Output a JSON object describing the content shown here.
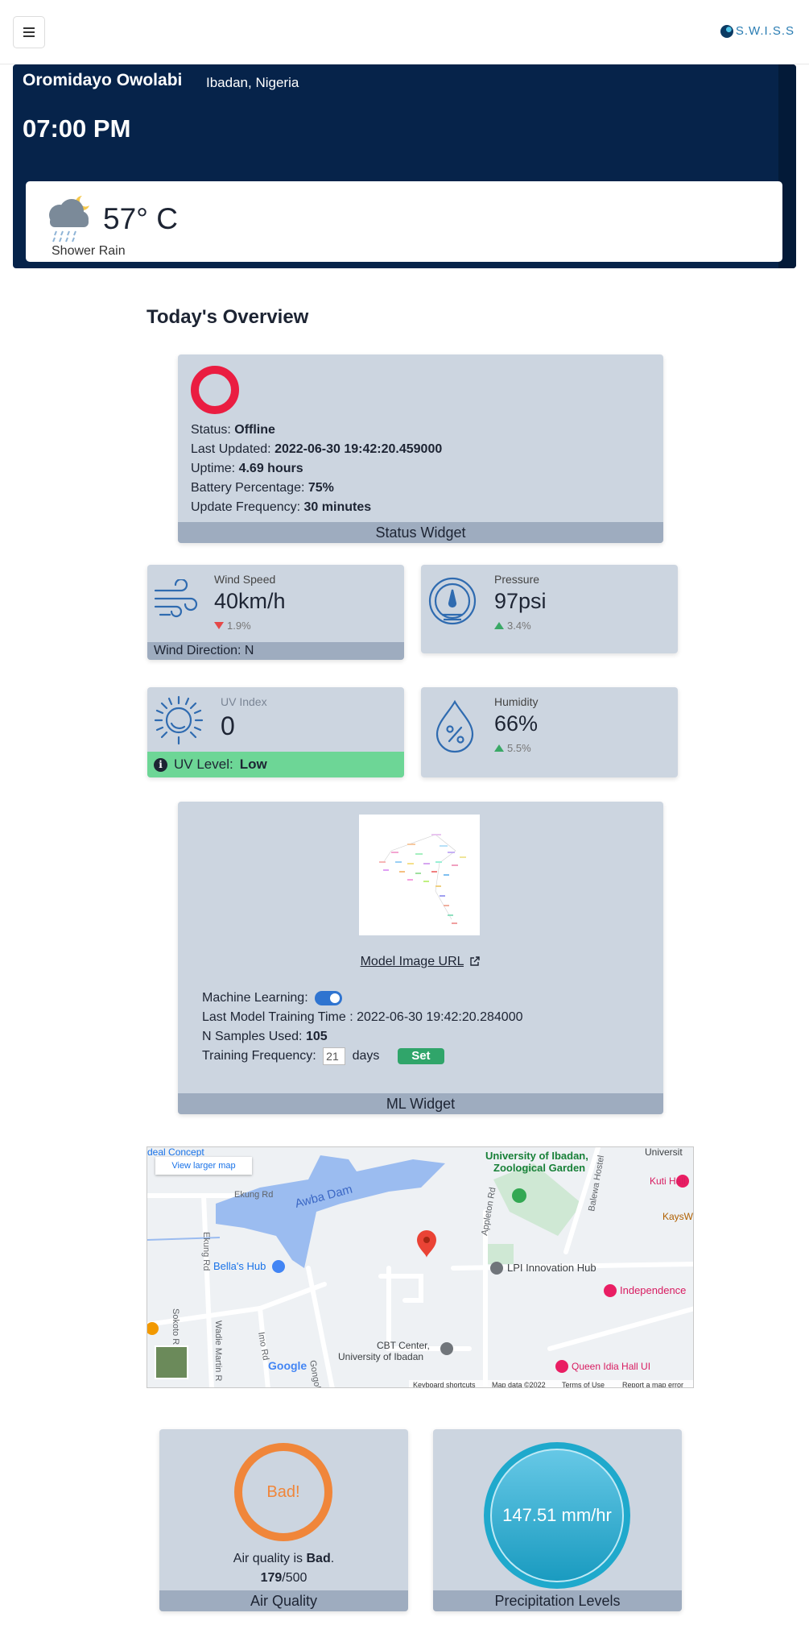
{
  "header": {
    "brand": "S.W.I.S.S",
    "menu_icon": "hamburger-icon",
    "logo_icon": "globe-logo-icon"
  },
  "hero": {
    "user_name": "Oromidayo Owolabi",
    "location": "Ibadan, Nigeria",
    "time": "07:00 PM",
    "weather": {
      "icon": "cloud-moon-rain-icon",
      "temperature": "57° C",
      "description": "Shower Rain"
    }
  },
  "overview": {
    "title": "Today's Overview",
    "status_widget": {
      "status_label": "Status: ",
      "status_value": "Offline",
      "updated_label": "Last Updated: ",
      "updated_value": "2022-06-30 19:42:20.459000",
      "uptime_label": "Uptime: ",
      "uptime_value": "4.69 hours",
      "battery_label": "Battery Percentage: ",
      "battery_value": "75%",
      "frequency_label": "Update Frequency: ",
      "frequency_value": "30 minutes",
      "footer": "Status Widget",
      "status_color": "#ea1d41"
    },
    "wind": {
      "label": "Wind Speed",
      "value": "40km/h",
      "change": "1.9%",
      "trend": "down",
      "direction": "Wind Direction: N",
      "icon": "wind-icon"
    },
    "pressure": {
      "label": "Pressure",
      "value": "97psi",
      "change": "3.4%",
      "trend": "up",
      "icon": "gauge-icon"
    },
    "uv": {
      "label": "UV Index",
      "value": "0",
      "level_label": "UV Level:",
      "level_value": "Low",
      "icon": "sun-icon"
    },
    "humidity": {
      "label": "Humidity",
      "value": "66%",
      "change": "5.5%",
      "trend": "up",
      "icon": "water-drop-percent-icon"
    },
    "ml_widget": {
      "link_text": "Model Image URL",
      "ml_label": "Machine Learning:",
      "ml_enabled": true,
      "training_time_label": "Last Model Training Time : ",
      "training_time_value": "2022-06-30 19:42:20.284000",
      "samples_label": "N Samples Used: ",
      "samples_value": "105",
      "frequency_label": "Training Frequency:",
      "frequency_value": "21",
      "frequency_unit": "days",
      "set_button": "Set",
      "footer": "ML Widget"
    },
    "map": {
      "view_larger": "View larger map",
      "places": [
        "University of Ibadan, Zoological Garden",
        "Kuti Hall",
        "KaysWeeke",
        "Bella's Hub",
        "LPI Innovation Hub",
        "Independence",
        "CBT Center, University of Ibadan",
        "Queen Idia Hall UI",
        "Awba Dam",
        "deal Concept",
        "Universit"
      ],
      "roads": [
        "Ekung Rd",
        "Ekung Rd",
        "Appleton Rd",
        "Balewa Hostel",
        "Sokoto R",
        "Wadie Martin R",
        "Imo Rd",
        "Gongol"
      ],
      "footer_items": [
        "Keyboard shortcuts",
        "Map data ©2022",
        "Terms of Use",
        "Report a map error"
      ],
      "google": "Google"
    },
    "air_quality": {
      "badge": "Bad!",
      "text_prefix": "Air quality is ",
      "text_value": "Bad",
      "text_suffix": ".",
      "score": "179",
      "score_max": "/500",
      "footer": "Air Quality",
      "ring_color": "#f0863a",
      "score_fraction": 0.358
    },
    "precipitation": {
      "value": "147.51 mm/hr",
      "footer": "Precipitation Levels",
      "ring_color": "#1fa9cc"
    }
  }
}
